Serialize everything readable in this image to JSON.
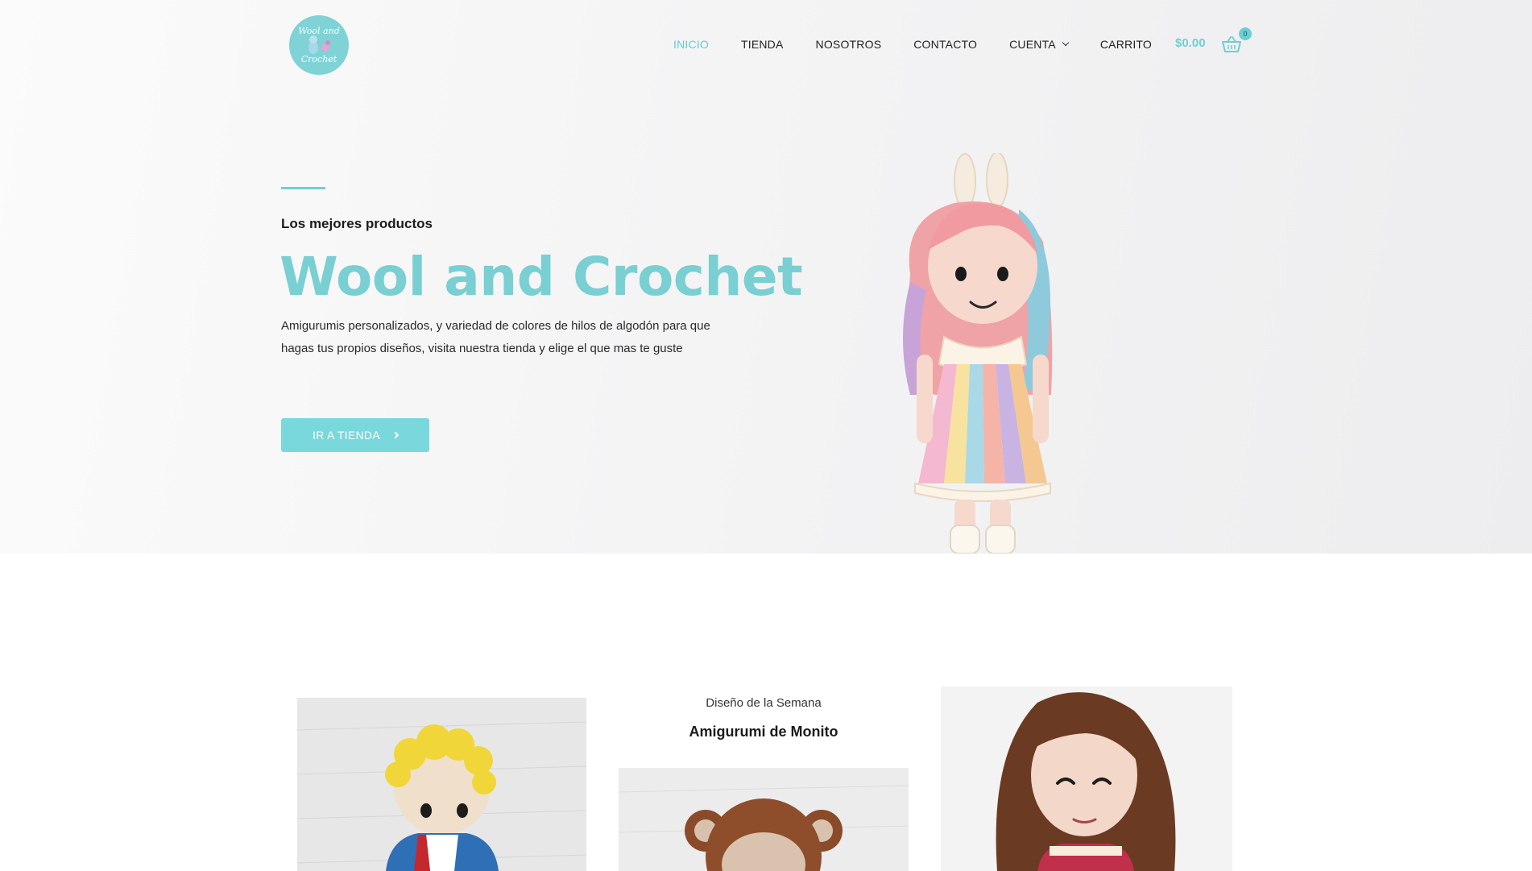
{
  "brand": {
    "logo_line1": "Wool and",
    "logo_line2": "Crochet",
    "accent_color": "#6ecfd3"
  },
  "nav": {
    "items": [
      {
        "label": "INICIO",
        "active": true
      },
      {
        "label": "TIENDA",
        "active": false
      },
      {
        "label": "NOSOTROS",
        "active": false
      },
      {
        "label": "CONTACTO",
        "active": false
      },
      {
        "label": "CUENTA",
        "active": false,
        "has_dropdown": true
      },
      {
        "label": "CARRITO",
        "active": false
      }
    ]
  },
  "cart": {
    "total": "$0.00",
    "count": "0",
    "icon": "basket-icon"
  },
  "hero": {
    "eyebrow": "Los mejores productos",
    "title": "Wool and Crochet",
    "description": "Amigurumis personalizados, y variedad de colores de hilos de algodón para que hagas tus propios diseños, visita nuestra tienda y elige el que mas te guste",
    "button_label": "IR A TIENDA",
    "image": "crochet-bunny-doll"
  },
  "featured": {
    "label": "Diseño de la Semana",
    "title": "Amigurumi de Monito",
    "images": [
      "crochet-prince-doll",
      "crochet-monkey",
      "crochet-brunette-doll"
    ]
  }
}
